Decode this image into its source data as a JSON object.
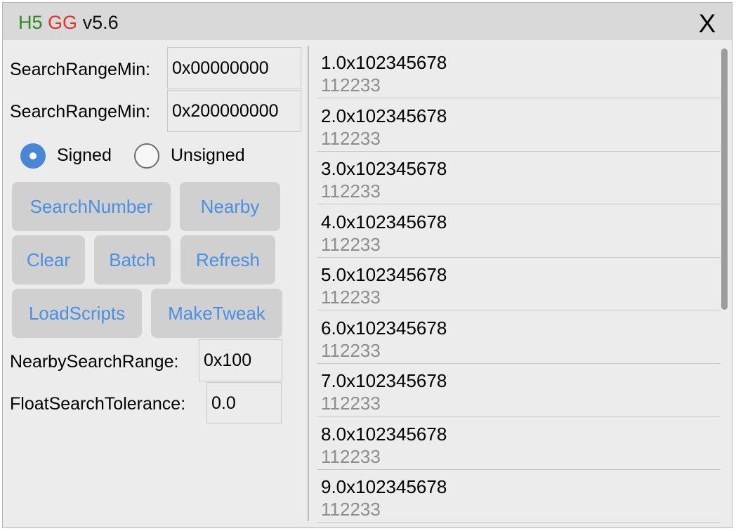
{
  "titlebar": {
    "title_h5": "H5",
    "title_gg": "GG",
    "title_version": "v5.6",
    "close_label": "X"
  },
  "form": {
    "range_min_label": "SearchRangeMin:",
    "range_min_value": "0x00000000",
    "range_max_label": "SearchRangeMin:",
    "range_max_value": "0x200000000",
    "signed_label": "Signed",
    "unsigned_label": "Unsigned",
    "selected_sign": "Signed",
    "nearby_range_label": "NearbySearchRange:",
    "nearby_range_value": "0x100",
    "float_tolerance_label": "FloatSearchTolerance:",
    "float_tolerance_value": "0.0"
  },
  "buttons": {
    "search_number": "SearchNumber",
    "nearby": "Nearby",
    "clear": "Clear",
    "batch": "Batch",
    "refresh": "Refresh",
    "load_scripts": "LoadScripts",
    "make_tweak": "MakeTweak"
  },
  "results": [
    {
      "address": "1.0x102345678",
      "value": "112233"
    },
    {
      "address": "2.0x102345678",
      "value": "112233"
    },
    {
      "address": "3.0x102345678",
      "value": "112233"
    },
    {
      "address": "4.0x102345678",
      "value": "112233"
    },
    {
      "address": "5.0x102345678",
      "value": "112233"
    },
    {
      "address": "6.0x102345678",
      "value": "112233"
    },
    {
      "address": "7.0x102345678",
      "value": "112233"
    },
    {
      "address": "8.0x102345678",
      "value": "112233"
    },
    {
      "address": "9.0x102345678",
      "value": "112233"
    }
  ],
  "colors": {
    "accent_blue": "#4a90e2",
    "title_green": "#2f8a1f",
    "title_red": "#e0332a",
    "button_bg": "#d0d0d0"
  },
  "icons": {
    "close": "close-icon",
    "radio_selected": "radio-checked-icon",
    "radio_unselected": "radio-unchecked-icon"
  }
}
